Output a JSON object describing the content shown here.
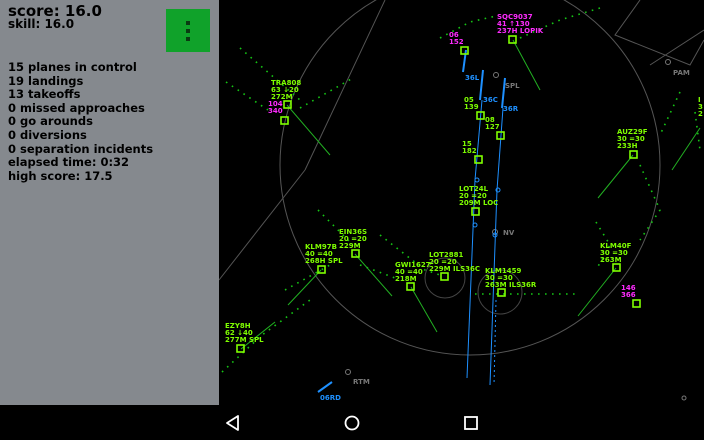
{
  "panel": {
    "score": "score: 16.0",
    "skill": "skill: 16.0",
    "stats": [
      "15 planes in control",
      "19 landings",
      "13 takeoffs",
      "0 missed approaches",
      "0 go arounds",
      "0 diversions",
      "0 separation incidents",
      "elapsed time: 0:32",
      "high score: 17.5"
    ]
  },
  "menu_icon": "vertical-dots-icon",
  "colors": {
    "controlled": "#7fff00",
    "uncontrolled": "#ff2bff",
    "runway": "#1e90ff",
    "beacon": "#777777"
  },
  "runways": [
    "36L",
    "36C",
    "36R",
    "06RD"
  ],
  "beacons": [
    "PAM",
    "SPL",
    "NV",
    "RTM"
  ],
  "aircraft": [
    {
      "id": "sqc9037",
      "line1": "SQC9037",
      "line2": "41 ↑130",
      "line3": "237H LOPIK",
      "controlled": false
    },
    {
      "id": "a06",
      "line1": "06",
      "line2": "152",
      "controlled": false
    },
    {
      "id": "tra808",
      "line1": "TRA808",
      "line2": "63 ↓20",
      "line3": "272M",
      "controlled": true
    },
    {
      "id": "a104",
      "line1": "104",
      "line2": "340",
      "controlled": false
    },
    {
      "id": "a05",
      "line1": "05",
      "line2": "139",
      "controlled": true
    },
    {
      "id": "a08",
      "line1": "08",
      "line2": "127",
      "controlled": true
    },
    {
      "id": "a15",
      "line1": "15",
      "line2": "182",
      "controlled": true
    },
    {
      "id": "auz29f",
      "line1": "AUZ29F",
      "line2": "30 =30",
      "line3": "233H",
      "controlled": true
    },
    {
      "id": "lot24l",
      "line1": "LOT24L",
      "line2": "20 =20",
      "line3": "209M LOC",
      "controlled": true
    },
    {
      "id": "ein36s",
      "line1": "EIN36S",
      "line2": "20 =20",
      "line3": "229M",
      "controlled": true
    },
    {
      "id": "klm97b",
      "line1": "KLM97B",
      "line2": "40 =40",
      "line3": "268H SPL",
      "controlled": true
    },
    {
      "id": "lot2881",
      "line1": "LOT2881",
      "line2": "20 =20",
      "line3": "229M ILS36C",
      "controlled": true
    },
    {
      "id": "gwi1627",
      "line1": "GWI1627",
      "line2": "40 =40",
      "line3": "218M",
      "controlled": true
    },
    {
      "id": "klm1459",
      "line1": "KLM1459",
      "line2": "30 =30",
      "line3": "263M ILS36R",
      "controlled": true
    },
    {
      "id": "klm40f",
      "line1": "KLM40F",
      "line2": "30 =30",
      "line3": "263M",
      "controlled": true
    },
    {
      "id": "a146",
      "line1": "146",
      "line2": "366",
      "controlled": false
    },
    {
      "id": "ezy8h",
      "line1": "EZY8H",
      "line2": "62 ↓40",
      "line3": "277M SPL",
      "controlled": true
    }
  ],
  "nav": {
    "back": "back-icon",
    "home": "home-icon",
    "recents": "recents-icon"
  }
}
